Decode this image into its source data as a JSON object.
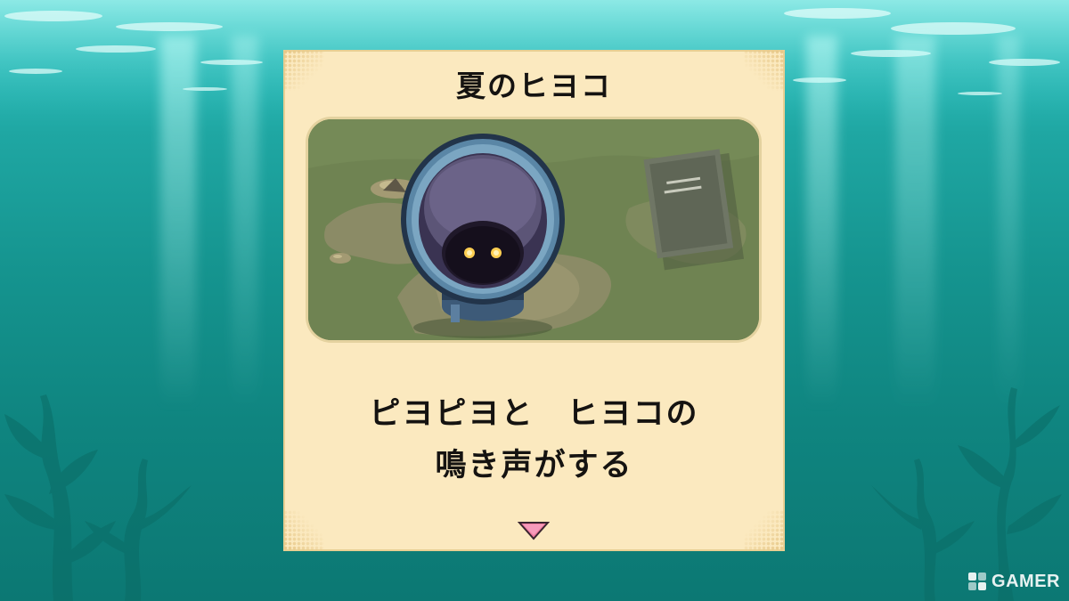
{
  "dialog": {
    "title": "夏のヒヨコ",
    "message_lines": [
      "ピヨピヨと　ヒヨコの",
      "鳴き声がする"
    ],
    "advance_icon": "triangle-down-icon"
  },
  "scene": {
    "description_icon": "barrel-with-glowing-eyes",
    "colors": {
      "grass": "#6b7f4e",
      "dirt": "#8b8a67",
      "barrel": "#3f5f7e",
      "barrel_rim": "#7aa2c0",
      "eyes": "#ffcf52"
    }
  },
  "watermark": {
    "text": "GAMER",
    "icon": "gamer-logo-icon"
  },
  "colors": {
    "water_top": "#4fd9d6",
    "water_bottom": "#0c7873",
    "dialog_bg": "#fbe9bf",
    "text": "#151311",
    "arrow": "#f07ca1"
  }
}
